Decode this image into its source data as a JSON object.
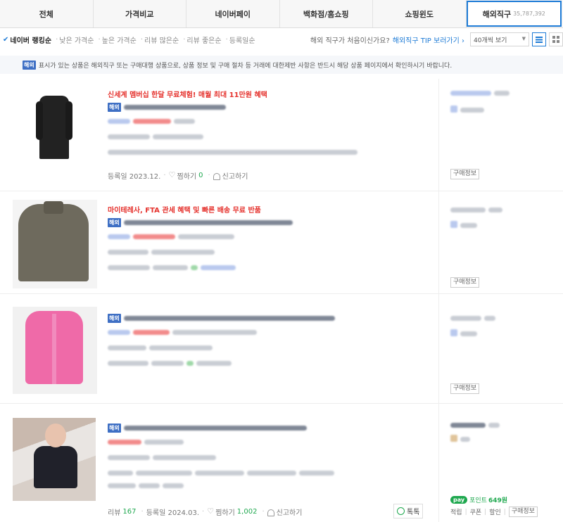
{
  "tabs": [
    {
      "label": "전체"
    },
    {
      "label": "가격비교"
    },
    {
      "label": "네이버페이"
    },
    {
      "label": "백화점/홈쇼핑"
    },
    {
      "label": "쇼핑윈도"
    },
    {
      "label": "해외직구",
      "count": "35,787,392"
    }
  ],
  "sort": {
    "items": [
      "네이버 랭킹순",
      "낮은 가격순",
      "높은 가격순",
      "리뷰 많은순",
      "리뷰 좋은순",
      "등록일순"
    ],
    "question": "해외 직구가 처음이신가요?",
    "tip_link": "해외직구 TIP 보러가기",
    "page_size": "40개씩 보기"
  },
  "notice": {
    "badge": "해외",
    "text": "표시가 있는 상품은 해외직구 또는 구매대행 상품으로, 상품 정보 및 구매 절차 등 거래에 대한제반 사항은 반드시 해당 상품 페이지에서 확인하시기 바랍니다."
  },
  "products": [
    {
      "promo": "신세계 멤버십 한달 무료체험! 매월 최대 11만원 혜택",
      "badge": "해외",
      "reg": "등록일 2023.12.",
      "wish_label": "찜하기",
      "wish_count": "0",
      "report": "신고하기",
      "buy_info": "구매정보"
    },
    {
      "promo": "마이테레사, FTA 관세 혜택 및 빠른 배송 무료 반품",
      "badge": "해외",
      "buy_info": "구매정보"
    },
    {
      "badge": "해외",
      "buy_info": "구매정보"
    },
    {
      "badge": "해외",
      "review_label": "리뷰",
      "review_count": "167",
      "reg": "등록일 2024.03.",
      "wish_label": "찜하기",
      "wish_count": "1,002",
      "report": "신고하기",
      "talk": "톡톡",
      "pay_logo": "pay",
      "point_label": "포인트",
      "point_value": "649원",
      "benefits": [
        "적립",
        "쿠폰",
        "할인"
      ],
      "buy_info": "구매정보"
    }
  ],
  "colors": {
    "accent": "#1e7bd6",
    "promo_red": "#e5322d",
    "badge_blue": "#3e6fc4",
    "green": "#1fa84f"
  }
}
